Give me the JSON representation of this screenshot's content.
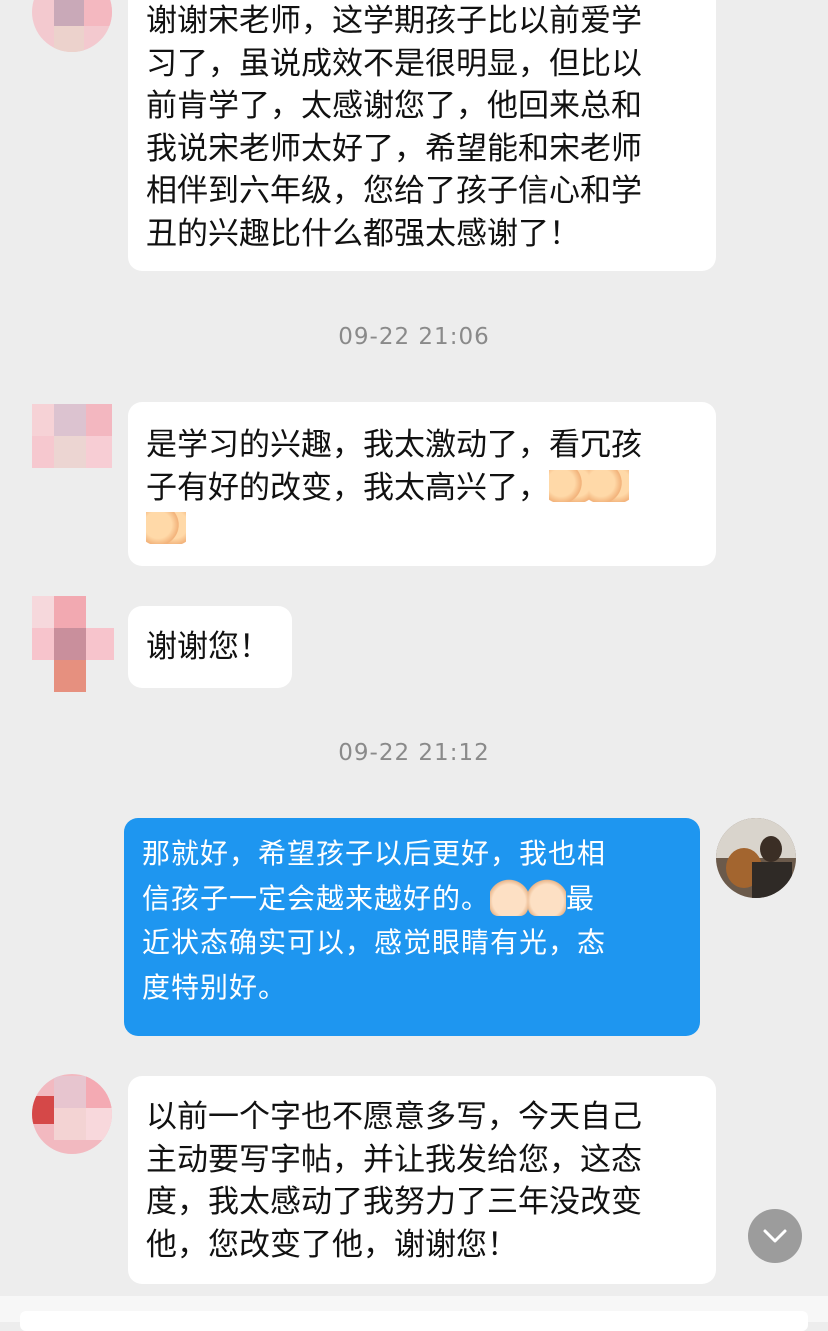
{
  "messages": [
    {
      "id": "m1",
      "lines": [
        "谢谢宋老师，这学期孩子比以前爱学",
        "习了，虽说成效不是很明显，但比以",
        "前肯学了，太感谢您了，他回来总和",
        "我说宋老师太好了，希望能和宋老师",
        "相伴到六年级，您给了孩子信心和学",
        "丑的兴趣比什么都强太感谢了！"
      ]
    },
    {
      "id": "m2",
      "lines": [
        "是学习的兴趣，我太激动了，看冗孩",
        "子有好的改变，我太高兴了，"
      ],
      "emoji": [
        "folded-hands-emoji",
        "folded-hands-emoji",
        "folded-hands-emoji"
      ]
    },
    {
      "id": "m3",
      "lines": [
        "谢谢您！"
      ]
    },
    {
      "id": "m4",
      "lines": [
        "那就好，希望孩子以后更好，我也相",
        "信孩子一定会越来越好的。",
        "近状态确实可以，感觉眼睛有光，态",
        "度特别好。"
      ],
      "inline_after_line2": "最",
      "emoji": [
        "thumbs-up-emoji",
        "thumbs-up-emoji"
      ]
    },
    {
      "id": "m5",
      "lines": [
        "以前一个字也不愿意多写，今天自己",
        "主动要写字帖，并让我发给您，这态",
        "度，我太感动了我努力了三年没改变",
        "他，您改变了他，谢谢您！"
      ]
    }
  ],
  "timestamps": [
    "09-22 21:06",
    "09-22 21:12"
  ],
  "icons": {
    "scroll_down": "chevron-down-icon"
  },
  "colors": {
    "background": "#ededed",
    "incoming_bubble": "#ffffff",
    "outgoing_bubble": "#1e96f0"
  }
}
